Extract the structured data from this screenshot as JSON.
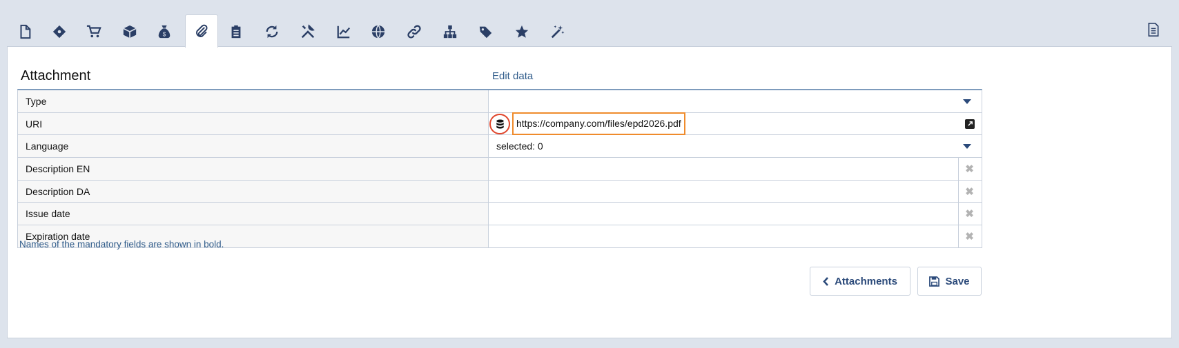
{
  "tabs": [
    {
      "icon": "file-icon"
    },
    {
      "icon": "tag-diamond-icon"
    },
    {
      "icon": "cart-icon"
    },
    {
      "icon": "box-icon"
    },
    {
      "icon": "money-bag-icon"
    },
    {
      "icon": "paperclip-icon",
      "active": true
    },
    {
      "icon": "clipboard-list-icon"
    },
    {
      "icon": "sync-icon"
    },
    {
      "icon": "tools-icon"
    },
    {
      "icon": "line-chart-icon"
    },
    {
      "icon": "globe-icon"
    },
    {
      "icon": "link-icon"
    },
    {
      "icon": "sitemap-icon"
    },
    {
      "icon": "tags-icon"
    },
    {
      "icon": "star-icon"
    },
    {
      "icon": "magic-wand-icon"
    }
  ],
  "header": {
    "title": "Attachment",
    "edit_link": "Edit data"
  },
  "fields": {
    "type": {
      "label": "Type",
      "value": ""
    },
    "uri": {
      "label": "URI",
      "value": "https://company.com/files/epd2026.pdf"
    },
    "language": {
      "label": "Language",
      "value": "selected: 0"
    },
    "description_en": {
      "label": "Description EN",
      "value": ""
    },
    "description_da": {
      "label": "Description DA",
      "value": ""
    },
    "issue_date": {
      "label": "Issue date",
      "value": ""
    },
    "expiration_date": {
      "label": "Expiration date",
      "value": ""
    }
  },
  "clear_symbol": "✖",
  "note": "Names of the mandatory fields are shown in bold.",
  "buttons": {
    "attachments": "Attachments",
    "save": "Save"
  },
  "colors": {
    "accent": "#2b4a7a",
    "highlight_circle": "#e0452b",
    "highlight_box": "#ef8b2c",
    "background": "#dde3ec"
  }
}
